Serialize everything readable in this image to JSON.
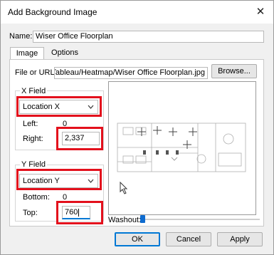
{
  "dialog": {
    "title": "Add Background Image",
    "close_glyph": "✕"
  },
  "name": {
    "label": "Name:",
    "value": "Wiser Office Floorplan"
  },
  "tabs": [
    {
      "label": "Image"
    },
    {
      "label": "Options"
    }
  ],
  "file": {
    "label": "File or URL:",
    "value": "Stuff/Tableau/Heatmap/Wiser Office Floorplan.jpg",
    "browse_label": "Browse..."
  },
  "x_field": {
    "group_label": "X Field",
    "selected": "Location X",
    "left_label": "Left:",
    "left_value": "0",
    "right_label": "Right:",
    "right_value": "2,337"
  },
  "y_field": {
    "group_label": "Y Field",
    "selected": "Location Y",
    "bottom_label": "Bottom:",
    "bottom_value": "0",
    "top_label": "Top:",
    "top_value": "760"
  },
  "washout": {
    "label": "Washout:",
    "value": 0.0
  },
  "buttons": {
    "ok": "OK",
    "cancel": "Cancel",
    "apply": "Apply"
  },
  "colors": {
    "highlight_red": "#e3101c",
    "slider_blue": "#0f6cd0",
    "focus_blue": "#0078d4"
  },
  "icons": {
    "dropdown": "chevron-down-icon",
    "close": "close-icon",
    "cursor": "mouse-cursor-icon"
  }
}
